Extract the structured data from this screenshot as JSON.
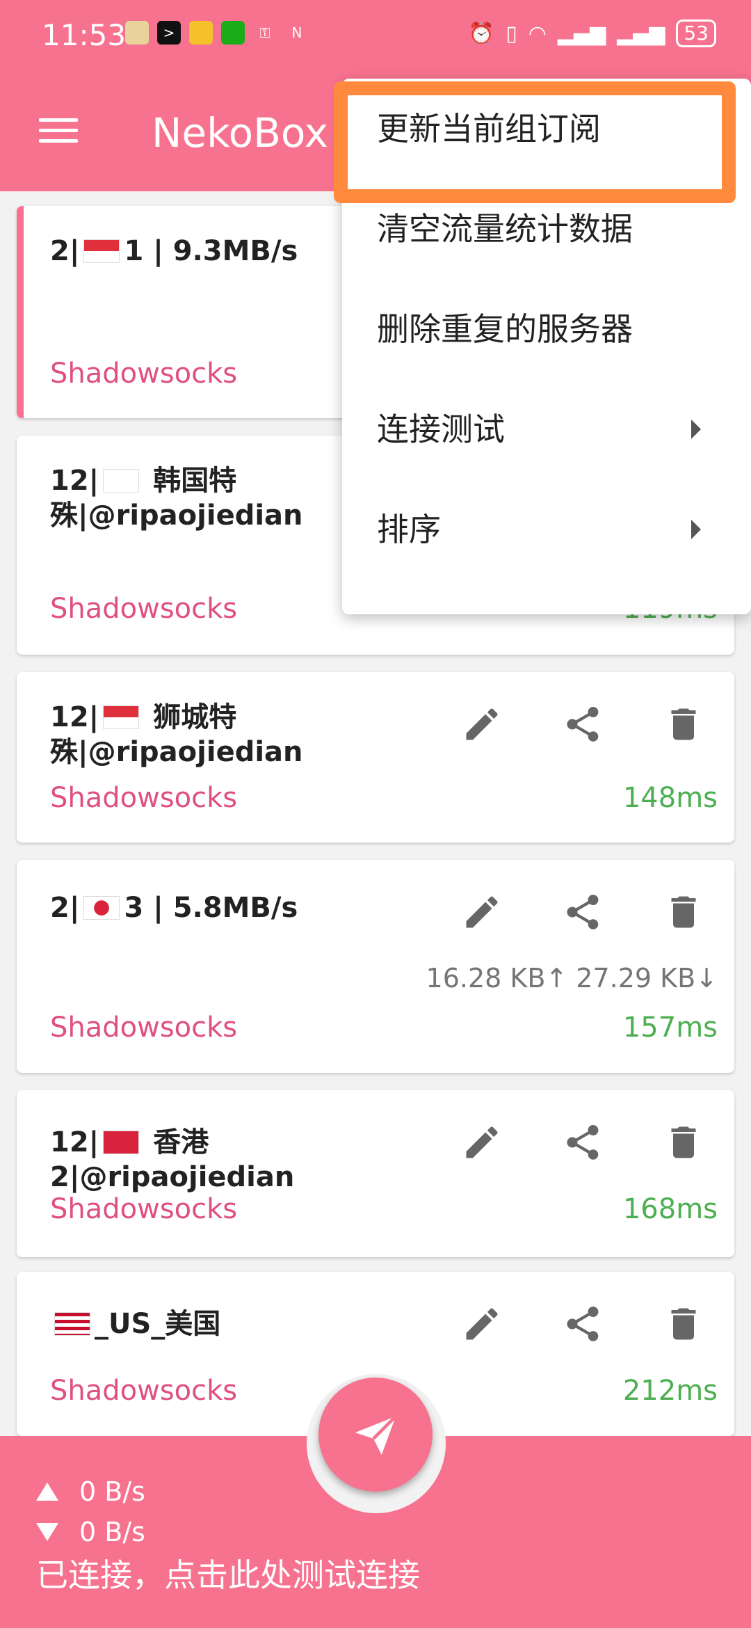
{
  "status_bar": {
    "time": "11:53",
    "battery": "53"
  },
  "toolbar": {
    "title": "NekoBox"
  },
  "menu": {
    "items": [
      {
        "label": "更新当前组订阅",
        "has_submenu": false
      },
      {
        "label": "清空流量统计数据",
        "has_submenu": false
      },
      {
        "label": "删除重复的服务器",
        "has_submenu": false
      },
      {
        "label": "连接测试",
        "has_submenu": true
      },
      {
        "label": "排序",
        "has_submenu": true
      }
    ]
  },
  "servers": [
    {
      "name_prefix": "2|",
      "flag": "sg",
      "name_suffix": "1 |  9.3MB/s",
      "type": "Shadowsocks",
      "latency": "",
      "traffic": ""
    },
    {
      "name_prefix": "12|",
      "flag": "kr",
      "name_suffix": " 韩国特殊|@ripaojiedian",
      "type": "Shadowsocks",
      "latency": "119ms",
      "traffic": ""
    },
    {
      "name_prefix": "12|",
      "flag": "sg",
      "name_suffix": " 狮城特殊|@ripaojiedian",
      "type": "Shadowsocks",
      "latency": "148ms",
      "traffic": ""
    },
    {
      "name_prefix": "2|",
      "flag": "jp",
      "name_suffix": "3 |  5.8MB/s",
      "type": "Shadowsocks",
      "latency": "157ms",
      "traffic": "16.28 KB↑ 27.29 KB↓"
    },
    {
      "name_prefix": "12|",
      "flag": "hk",
      "name_suffix": " 香港2|@ripaojiedian",
      "type": "Shadowsocks",
      "latency": "168ms",
      "traffic": ""
    },
    {
      "name_prefix": "",
      "flag": "us",
      "name_suffix": "_US_美国",
      "type": "Shadowsocks",
      "latency": "212ms",
      "traffic": ""
    }
  ],
  "bottom": {
    "upload": "0 B/s",
    "download": "0 B/s",
    "status": "已连接，点击此处测试连接"
  },
  "colors": {
    "primary": "#f7728f",
    "highlight": "#ff8a3d",
    "type_text": "#e0507e",
    "latency_text": "#4caf50"
  }
}
